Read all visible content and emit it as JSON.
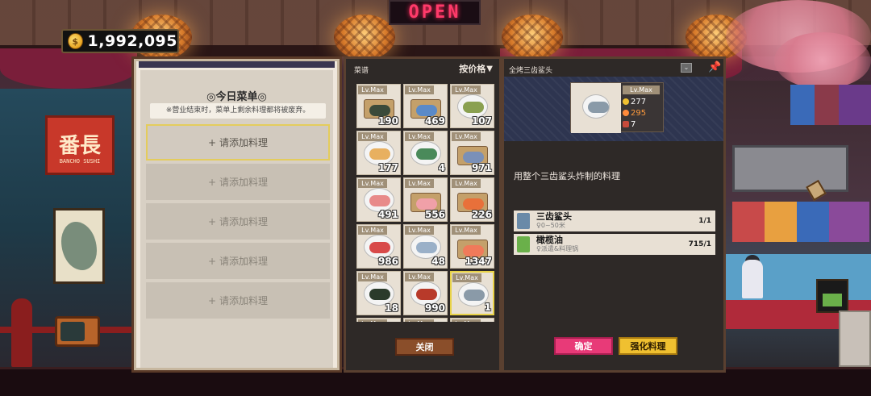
{
  "hud": {
    "coins": "1,992,095",
    "coin_glyph": "$",
    "open_sign": "OPEN",
    "shop_sign": "番長",
    "shop_sign_sub": "BANCHO SUSHI"
  },
  "menu_panel": {
    "title": "◎今日菜单◎",
    "notice": "※营业结束时，菜单上剩余料理都将被废弃。",
    "slots": [
      {
        "label": "请添加料理",
        "active": true
      },
      {
        "label": "请添加料理",
        "active": false
      },
      {
        "label": "请添加料理",
        "active": false
      },
      {
        "label": "请添加料理",
        "active": false
      },
      {
        "label": "请添加料理",
        "active": false
      }
    ]
  },
  "recipe_panel": {
    "title": "菜谱",
    "sort_label": "按价格",
    "close_label": "关闭",
    "level_label": "Lv.Max",
    "items": [
      {
        "count": "190",
        "style": "board",
        "food_color": "#3a4a3a"
      },
      {
        "count": "469",
        "style": "board",
        "food_color": "#5a8ac8"
      },
      {
        "count": "107",
        "style": "plate",
        "food_color": "#8aa050"
      },
      {
        "count": "177",
        "style": "plate",
        "food_color": "#e8b060"
      },
      {
        "count": "4",
        "style": "plate",
        "food_color": "#4a8a5a"
      },
      {
        "count": "971",
        "style": "board",
        "food_color": "#7a90b8"
      },
      {
        "count": "491",
        "style": "plate",
        "food_color": "#e88a8a"
      },
      {
        "count": "556",
        "style": "board",
        "food_color": "#f0a0a8"
      },
      {
        "count": "226",
        "style": "board",
        "food_color": "#e8703a"
      },
      {
        "count": "986",
        "style": "plate",
        "food_color": "#d84a4a"
      },
      {
        "count": "48",
        "style": "plate",
        "food_color": "#9ab0c8"
      },
      {
        "count": "1347",
        "style": "board",
        "food_color": "#f07a5a"
      },
      {
        "count": "18",
        "style": "plate",
        "food_color": "#2a3a2a"
      },
      {
        "count": "990",
        "style": "plate",
        "food_color": "#b83a2a"
      },
      {
        "count": "1",
        "style": "plate",
        "food_color": "#8a9aa8",
        "selected": true
      },
      {
        "count": "",
        "style": "board",
        "food_color": "#c0c0c0"
      },
      {
        "count": "",
        "style": "board",
        "food_color": "#c0c0c0"
      },
      {
        "count": "",
        "style": "board",
        "food_color": "#c0c0c0"
      }
    ]
  },
  "detail_panel": {
    "title": "全烤三齿鲨头",
    "level": "Lv.Max",
    "price": "277",
    "taste": "295",
    "score": "7",
    "description": "用整个三齿鲨头炸制的料理",
    "ingredients": [
      {
        "name": "三齿鲨头",
        "sub": "♀0~50米",
        "count": "1/1",
        "icon_color": "#6a8aa8"
      },
      {
        "name": "橄榄油",
        "sub": "♀派遣&料理锅",
        "count": "715/1",
        "icon_color": "#6ab04a"
      }
    ],
    "confirm_label": "确定",
    "upgrade_label": "强化料理"
  }
}
